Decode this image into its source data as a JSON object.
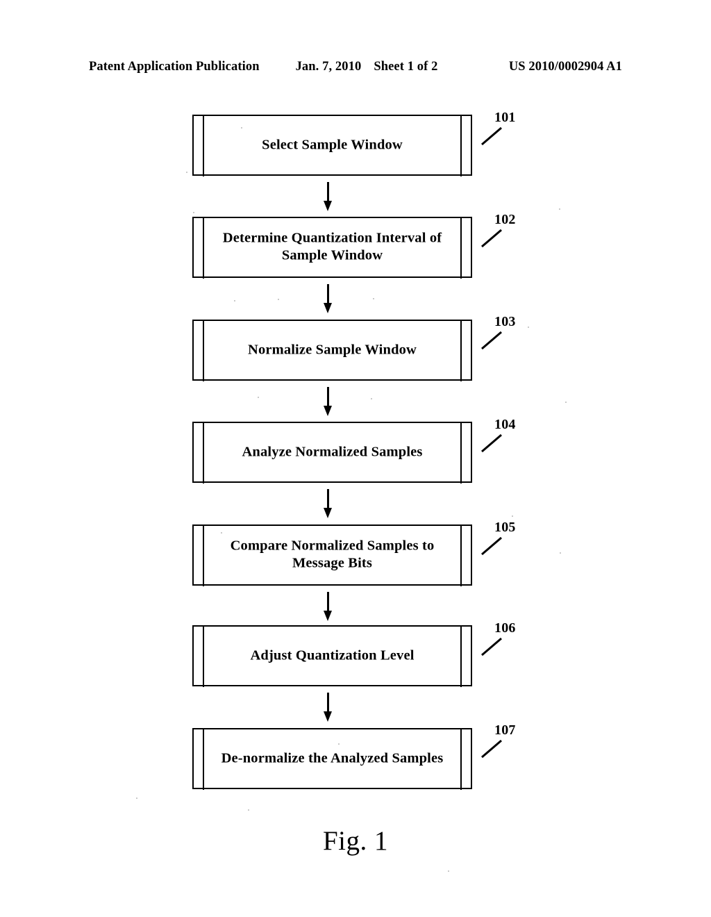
{
  "header": {
    "publication": "Patent Application Publication",
    "date": "Jan. 7, 2010",
    "sheet": "Sheet 1 of 2",
    "patent_number": "US 2010/0002904 A1"
  },
  "figure": {
    "caption": "Fig. 1",
    "accent_color": "#000000",
    "background_color": "#ffffff"
  },
  "flowchart": {
    "type": "vertical-sequence",
    "arrow_label": "flow-down",
    "steps": [
      {
        "ref": "101",
        "label": "Select Sample Window"
      },
      {
        "ref": "102",
        "label": "Determine Quantization Interval of\nSample Window"
      },
      {
        "ref": "103",
        "label": "Normalize Sample Window"
      },
      {
        "ref": "104",
        "label": "Analyze Normalized Samples"
      },
      {
        "ref": "105",
        "label": "Compare Normalized Samples to\nMessage Bits"
      },
      {
        "ref": "106",
        "label": "Adjust Quantization Level"
      },
      {
        "ref": "107",
        "label": "De-normalize the Analyzed Samples"
      }
    ]
  }
}
